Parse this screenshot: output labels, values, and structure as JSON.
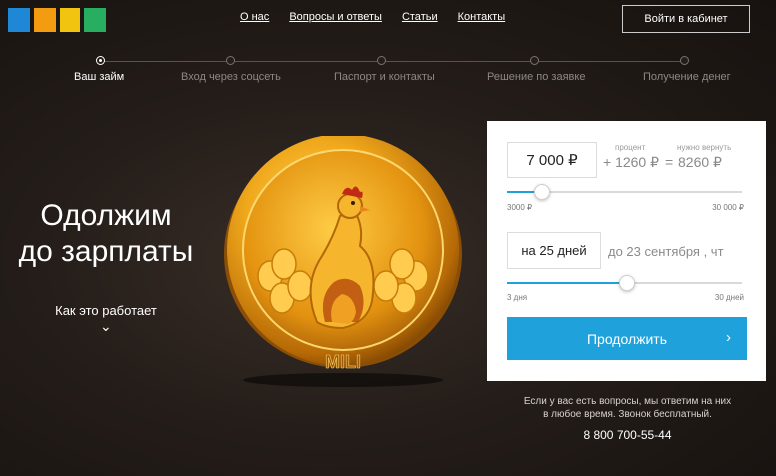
{
  "header": {
    "logo_colors": [
      "#1e88d6",
      "#f39c12",
      "#f1c40f",
      "#27ae60"
    ],
    "nav": [
      "О нас",
      "Вопросы и ответы",
      "Статьи",
      "Контакты"
    ],
    "login_label": "Войти  в кабинет"
  },
  "steps": [
    {
      "label": "Ваш займ",
      "active": true
    },
    {
      "label": "Вход через соцсеть",
      "active": false
    },
    {
      "label": "Паспорт и контакты",
      "active": false
    },
    {
      "label": "Решение по заявке",
      "active": false
    },
    {
      "label": "Получение денег",
      "active": false
    }
  ],
  "hero": {
    "title_line1": "Одолжим",
    "title_line2": "до зарплаты",
    "how_link": "Как это работает",
    "chevron": "⌄"
  },
  "coin": {
    "text": "MILI"
  },
  "calculator": {
    "amount_value": "7 000 ₽",
    "percent_caption": "процент",
    "return_caption": "нужно вернуть",
    "percent_value": "+ 1260 ₽",
    "equals": "=",
    "return_value": "8260 ₽",
    "amount_min": "3000 ₽",
    "amount_max": "30 000 ₽",
    "amount_fraction": 0.15,
    "term_value": "на 25 дней",
    "due_text": "до 23 сентября , чт",
    "term_min": "3 дня",
    "term_max": "30 дней",
    "term_fraction": 0.51,
    "continue_label": "Продолжить",
    "continue_arrow": "›"
  },
  "contact": {
    "note_line1": "Если у вас есть вопросы, мы ответим на них",
    "note_line2": "в любое время. Звонок бесплатный.",
    "phone": "8 800 700-55-44"
  }
}
